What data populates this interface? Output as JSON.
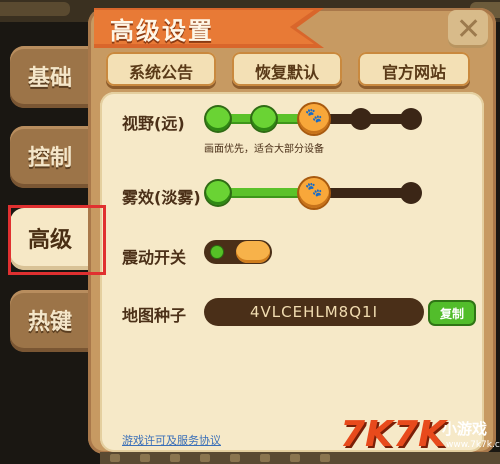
{
  "sidebar": {
    "tabs": [
      {
        "label": "基础",
        "active": false
      },
      {
        "label": "控制",
        "active": false
      },
      {
        "label": "高级",
        "active": true
      },
      {
        "label": "热键",
        "active": false
      }
    ]
  },
  "panel": {
    "title": "高级设置",
    "close_glyph": "✕",
    "buttons": {
      "announcement": "系统公告",
      "restore_default": "恢复默认",
      "official_site": "官方网站"
    }
  },
  "settings": {
    "view_distance": {
      "label": "视野(远)",
      "hint": "画面优先，适合大部分设备",
      "level": 3,
      "steps": 5
    },
    "fog": {
      "label": "雾效(淡雾)",
      "level": 2,
      "steps": 3
    },
    "vibration": {
      "label": "震动开关",
      "on": true
    },
    "map_seed": {
      "label": "地图种子",
      "value": "4VLCEHLM8Q1I",
      "copy_label": "复制"
    }
  },
  "footer": {
    "license_link": "游戏许可及服务协议"
  },
  "watermark": {
    "brand": "7K7K",
    "sub": "小游戏",
    "url": "www.7k7k.com"
  },
  "colors": {
    "accent_orange": "#e87a36",
    "slider_green": "#5cc22a",
    "knob_orange": "#f8a73a",
    "active_highlight": "#e03030"
  }
}
